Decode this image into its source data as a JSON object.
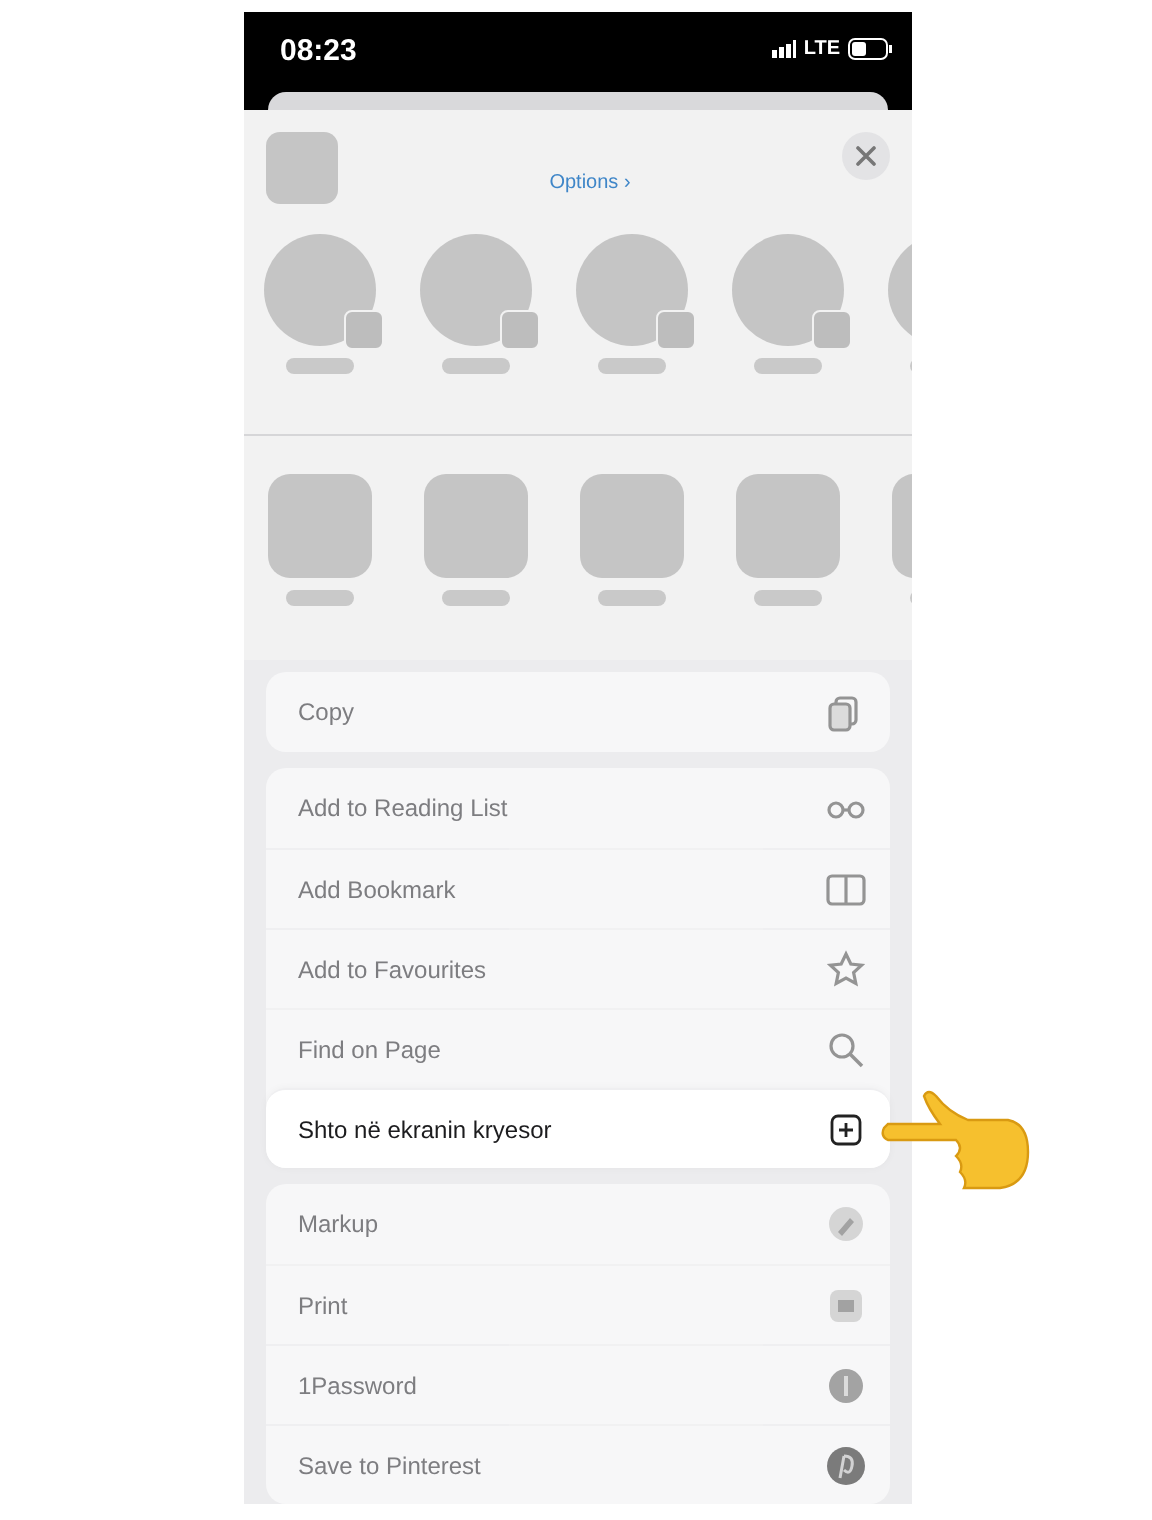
{
  "status_bar": {
    "time": "08:23",
    "network": "LTE"
  },
  "header": {
    "options_link": "Options ›"
  },
  "action_groups": [
    {
      "items": [
        {
          "label": "Copy",
          "kind": "copy",
          "highlighted": false
        }
      ]
    },
    {
      "items": [
        {
          "label": "Add to Reading List",
          "kind": "glasses",
          "highlighted": false
        },
        {
          "label": "Add Bookmark",
          "kind": "book",
          "highlighted": false
        },
        {
          "label": "Add to Favourites",
          "kind": "star",
          "highlighted": false
        },
        {
          "label": "Find on Page",
          "kind": "search",
          "highlighted": false
        },
        {
          "label": "Shto në ekranin kryesor",
          "kind": "add",
          "highlighted": true
        }
      ]
    },
    {
      "items": [
        {
          "label": "Markup",
          "kind": "markup",
          "highlighted": false
        },
        {
          "label": "Print",
          "kind": "print",
          "highlighted": false
        },
        {
          "label": "1Password",
          "kind": "password",
          "highlighted": false
        },
        {
          "label": "Save to Pinterest",
          "kind": "pinterest",
          "highlighted": false
        }
      ]
    }
  ]
}
